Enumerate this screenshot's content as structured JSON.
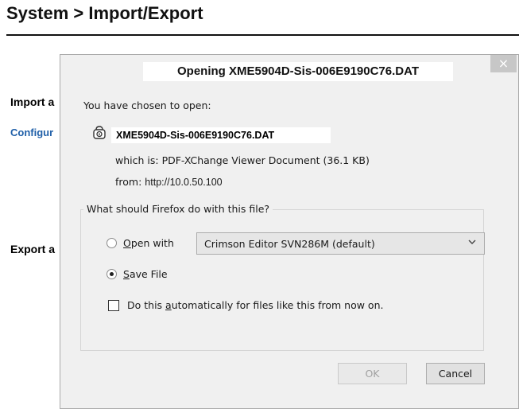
{
  "page": {
    "title": "System > Import/Export",
    "import_label": "Import a",
    "config_link": "Configur",
    "export_label": "Export a"
  },
  "dialog": {
    "title": "Opening XME5904D-Sis-006E9190C76.DAT",
    "close_glyph": "×",
    "chosen_text": "You have chosen to open:",
    "file_icon": "file-type-icon",
    "filename": "XME5904D-Sis-006E9190C76.DAT",
    "which_is_label": "which is:",
    "which_is_value": "PDF-XChange Viewer Document (36.1 KB)",
    "from_label": "from:",
    "from_value": "http://10.0.50.100",
    "question": "What should Firefox do with this file?",
    "open_with": {
      "label_accel": "O",
      "label_rest": "pen with",
      "selected": false,
      "app": "Crimson Editor SVN286M (default)"
    },
    "save_file": {
      "label_accel": "S",
      "label_rest": "ave File",
      "selected": true
    },
    "auto": {
      "label_pre": "Do this ",
      "label_accel": "a",
      "label_post": "utomatically for files like this from now on.",
      "checked": false
    },
    "ok_label": "OK",
    "cancel_label": "Cancel"
  }
}
